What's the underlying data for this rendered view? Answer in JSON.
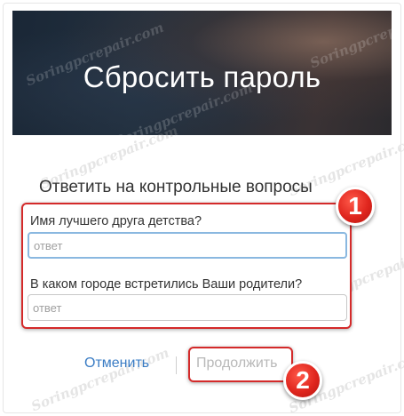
{
  "header": {
    "title": "Сбросить пароль"
  },
  "section": {
    "title": "Ответить на контрольные вопросы"
  },
  "questions": [
    {
      "label": "Имя лучшего друга детства?",
      "placeholder": "ответ"
    },
    {
      "label": "В каком городе встретились Ваши родители?",
      "placeholder": "ответ"
    }
  ],
  "actions": {
    "cancel_label": "Отменить",
    "continue_label": "Продолжить"
  },
  "badges": {
    "first": "1",
    "second": "2"
  },
  "watermark": {
    "text": "Soringpcrepair.com"
  },
  "colors": {
    "accent_red": "#d42a2a",
    "link_blue": "#3a7cc4",
    "disabled_gray": "#b8b8b8"
  }
}
